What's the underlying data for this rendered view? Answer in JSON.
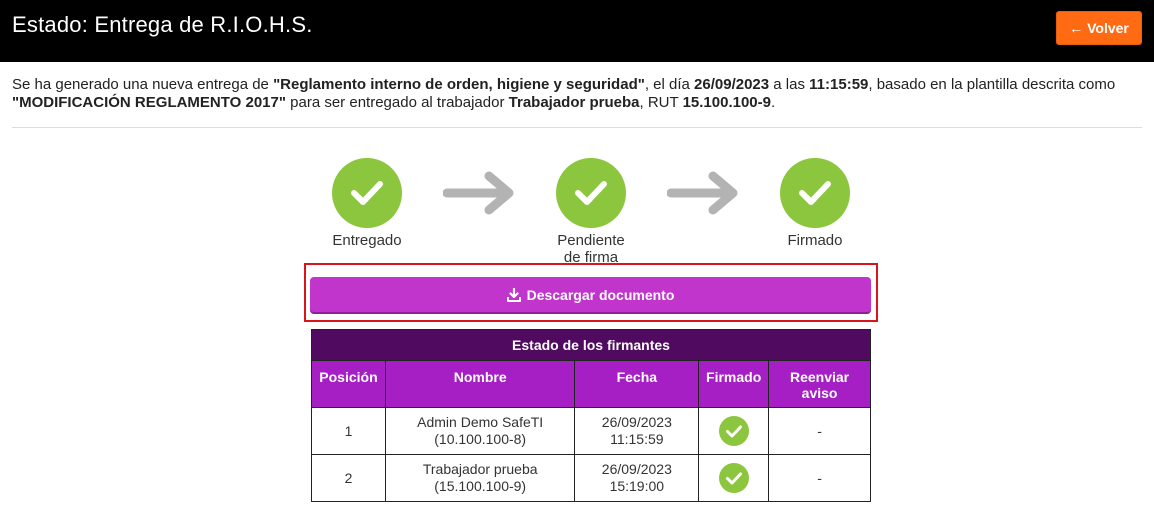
{
  "header": {
    "title": "Estado: Entrega de R.I.O.H.S.",
    "back_label": "Volver",
    "back_icon": "arrow-left-icon",
    "background": "#000000",
    "accent": "#ff6a13"
  },
  "intro": {
    "p1": "Se ha generado una nueva entrega de ",
    "doc_name": "\"Reglamento interno de orden, higiene y seguridad\"",
    "p2": ", el día ",
    "date": "26/09/2023",
    "p3": " a las ",
    "time": "11:15:59",
    "p4": ", basado en la plantilla descrita como ",
    "template": "\"MODIFICACIÓN REGLAMENTO 2017\"",
    "p5": " para ser entregado al trabajador ",
    "worker": "Trabajador prueba",
    "p6": ", RUT ",
    "rut": "15.100.100-9",
    "p7": "."
  },
  "steps": [
    {
      "label": "Entregado",
      "status": "done",
      "icon": "check-icon"
    },
    {
      "label_line1": "Pendiente",
      "label_line2": "de firma",
      "status": "done",
      "icon": "check-icon"
    },
    {
      "label": "Firmado",
      "status": "done",
      "icon": "check-icon"
    }
  ],
  "download": {
    "label": "Descargar documento",
    "icon": "download-icon",
    "color": "#c135cc"
  },
  "signers_table": {
    "caption": "Estado de los firmantes",
    "columns": [
      "Posición",
      "Nombre",
      "Fecha",
      "Firmado",
      "Reenviar aviso"
    ],
    "resend_line1": "Reenviar",
    "resend_line2": "aviso",
    "rows": [
      {
        "position": "1",
        "name": "Admin Demo SafeTI",
        "rut": "(10.100.100-8)",
        "date": "26/09/2023",
        "time": "11:15:59",
        "signed": true,
        "resend": "-"
      },
      {
        "position": "2",
        "name": "Trabajador prueba",
        "rut": "(15.100.100-9)",
        "date": "26/09/2023",
        "time": "15:19:00",
        "signed": true,
        "resend": "-"
      }
    ]
  }
}
